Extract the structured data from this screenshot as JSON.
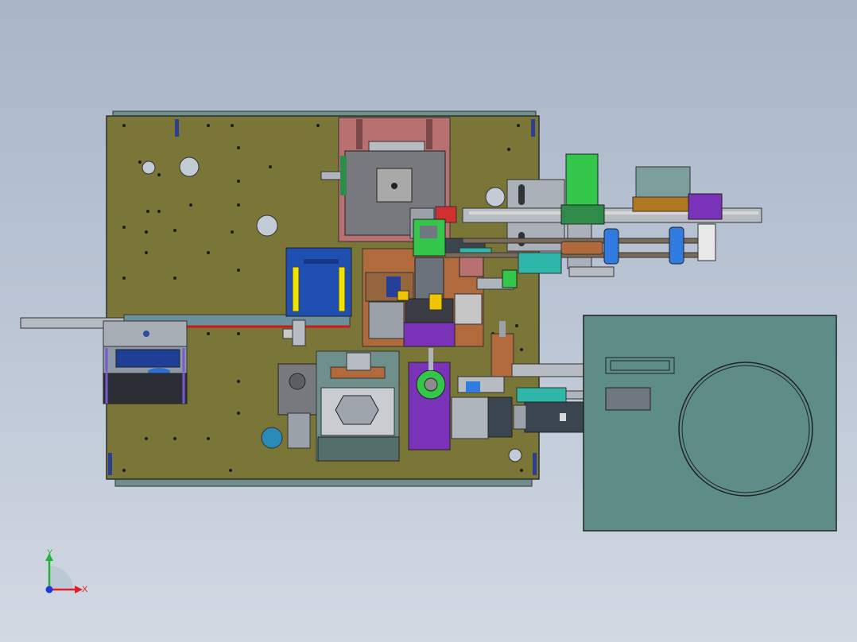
{
  "viewport": {
    "background_top": "#a9b6c8",
    "background_bottom": "#d2d9e3"
  },
  "model": {
    "plate_color": "#7a7638",
    "outline_color": "#2e2e2e",
    "parts": {
      "feeder_block": "#1f4fb0",
      "feeder_stripes": "#f0e400",
      "copper_plates": "#b06a3c",
      "pink_frame": "#b87070",
      "purple_parts": "#7a33b8",
      "motor_green": "#33c64a",
      "teal_blocks": "#2fb7aa",
      "servo_body": "#3a4550",
      "blue_rollers": "#2f7be0",
      "round_table": "#5e8d87"
    }
  },
  "axis_triad": {
    "x_label": "X",
    "y_label": "Y",
    "x_color": "#e0212b",
    "y_color": "#21b33a",
    "z_color": "#1f39d9"
  }
}
